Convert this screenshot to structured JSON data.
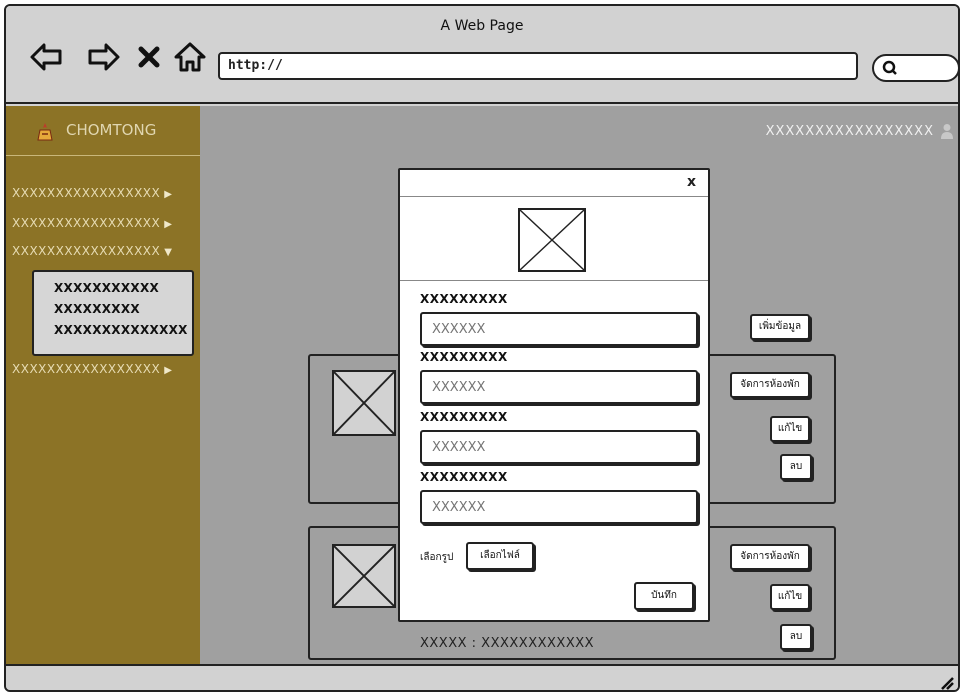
{
  "browser": {
    "title": "A Web Page",
    "url": "http://",
    "nav_icons": [
      "back-arrow-icon",
      "forward-arrow-icon",
      "stop-icon",
      "home-icon"
    ],
    "search_icon": "search-icon"
  },
  "header": {
    "brand": "CHOMTONG",
    "user_name": "XXXXXXXXXXXXXXXXX",
    "user_icon": "user-icon"
  },
  "sidebar": {
    "items": [
      {
        "label": "XXXXXXXXXXXXXXXXX",
        "state": "collapsed"
      },
      {
        "label": "XXXXXXXXXXXXXXXXX",
        "state": "collapsed"
      },
      {
        "label": "XXXXXXXXXXXXXXXXX",
        "state": "expanded"
      },
      {
        "label": "XXXXXXXXXXXXXXXXX",
        "state": "collapsed"
      }
    ],
    "submenu": [
      "XXXXXXXXXXX",
      "XXXXXXXXX",
      "XXXXXXXXXXXXXX"
    ]
  },
  "content": {
    "add_button": "เพิ่มข้อมูล",
    "cards": [
      {
        "manage_button": "จัดการห้องพัก",
        "edit_button": "แก้ไข",
        "delete_button": "ลบ"
      },
      {
        "manage_button": "จัดการห้องพัก",
        "edit_button": "แก้ไข",
        "delete_button": "ลบ",
        "caption": "XXXXX : XXXXXXXXXXXX"
      }
    ]
  },
  "modal": {
    "close": "x",
    "fields": [
      {
        "label": "XXXXXXXXX",
        "placeholder": "XXXXXX"
      },
      {
        "label": "XXXXXXXXX",
        "placeholder": "XXXXXX"
      },
      {
        "label": "XXXXXXXXX",
        "placeholder": "XXXXXX"
      },
      {
        "label": "XXXXXXXXX",
        "placeholder": "XXXXXX"
      }
    ],
    "choose_image_label": "เลือกรูป",
    "choose_file_button": "เลือกไฟล์",
    "save_button": "บันทึก"
  },
  "colors": {
    "sidebar": "#8c7326",
    "content_bg": "#a0a0a0",
    "chrome": "#d2d2d2"
  }
}
